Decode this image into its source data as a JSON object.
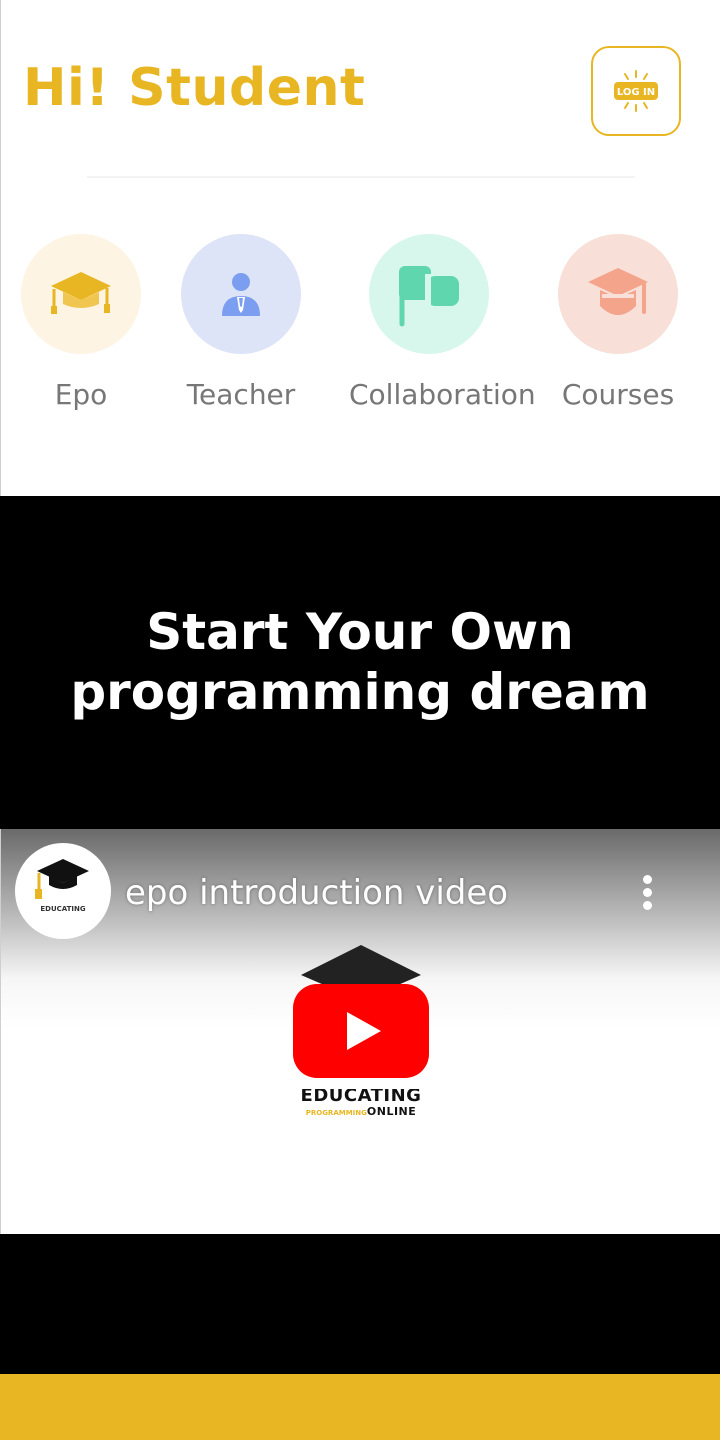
{
  "colors": {
    "accent": "#e8b623",
    "hero_bg": "#000000",
    "text_muted": "#777777"
  },
  "header": {
    "greeting": "Hi! Student",
    "login_icon_text": "LOG IN"
  },
  "categories": [
    {
      "label": "Epo",
      "icon": "graduation-cap-icon",
      "bg": "#fdf4e3",
      "color": "#e8b623"
    },
    {
      "label": "Teacher",
      "icon": "teacher-icon",
      "bg": "#dde4f7",
      "color": "#7c9ef0"
    },
    {
      "label": "Collaboration",
      "icon": "chat-bubbles-icon",
      "bg": "#d7f6ec",
      "color": "#5fd6ad"
    },
    {
      "label": "Courses",
      "icon": "courses-cap-icon",
      "bg": "#f8e0d8",
      "color": "#f4a48a"
    }
  ],
  "hero": {
    "line1": "Start Your Own",
    "line2": "programming dream"
  },
  "video": {
    "title": "epo introduction video",
    "logo_word": "EDUCATING",
    "logo_sub_prog": "PROGRAMMING",
    "logo_sub_online": "ONLINE"
  }
}
